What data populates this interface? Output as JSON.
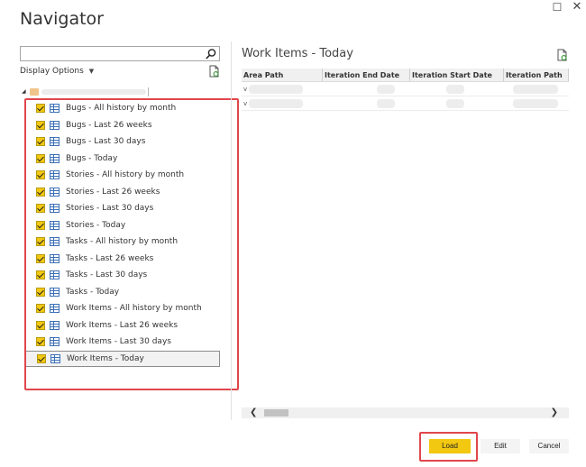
{
  "window": {
    "title": "Navigator"
  },
  "search": {
    "placeholder": ""
  },
  "display_options": {
    "label": "Display Options"
  },
  "items": [
    {
      "label": "Bugs - All history by month",
      "checked": true
    },
    {
      "label": "Bugs - Last 26 weeks",
      "checked": true
    },
    {
      "label": "Bugs - Last 30 days",
      "checked": true
    },
    {
      "label": "Bugs - Today",
      "checked": true
    },
    {
      "label": "Stories - All history by month",
      "checked": true
    },
    {
      "label": "Stories - Last 26 weeks",
      "checked": true
    },
    {
      "label": "Stories - Last 30 days",
      "checked": true
    },
    {
      "label": "Stories - Today",
      "checked": true
    },
    {
      "label": "Tasks - All history by month",
      "checked": true
    },
    {
      "label": "Tasks - Last 26 weeks",
      "checked": true
    },
    {
      "label": "Tasks - Last 30 days",
      "checked": true
    },
    {
      "label": "Tasks - Today",
      "checked": true
    },
    {
      "label": "Work Items - All history by month",
      "checked": true
    },
    {
      "label": "Work Items - Last 26 weeks",
      "checked": true
    },
    {
      "label": "Work Items - Last 30 days",
      "checked": true
    },
    {
      "label": "Work Items - Today",
      "checked": true,
      "selected": true
    }
  ],
  "preview": {
    "title": "Work Items - Today",
    "columns": [
      "Area Path",
      "Iteration End Date",
      "Iteration Start Date",
      "Iteration Path"
    ],
    "rows": [
      [
        "v",
        "",
        "",
        ""
      ],
      [
        "v",
        "",
        "",
        ""
      ]
    ]
  },
  "buttons": {
    "load": "Load",
    "edit": "Edit",
    "cancel": "Cancel"
  },
  "icons": {
    "search": "search-icon",
    "refresh": "refresh-icon",
    "checkbox": "checkbox-icon",
    "table": "table-icon"
  },
  "colors": {
    "accent": "#f2c811",
    "highlight": "#e0474c"
  }
}
